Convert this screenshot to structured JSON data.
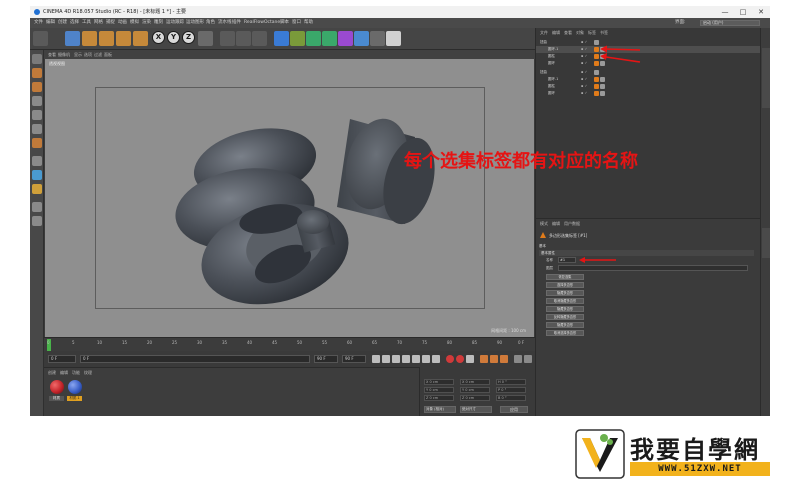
{
  "window": {
    "title": "CINEMA 4D R18.057 Studio (RC - R18) - [未标题 1 *] - 主要",
    "buttons": [
      "—",
      "□",
      "✕"
    ]
  },
  "menubar": {
    "items": [
      "文件",
      "编辑",
      "创建",
      "选择",
      "工具",
      "网格",
      "捕捉",
      "动画",
      "模拟",
      "渲染",
      "雕刻",
      "运动跟踪",
      "运动图形",
      "角色",
      "流水线",
      "插件",
      "RealFlow",
      "Octane",
      "脚本",
      "窗口",
      "帮助"
    ],
    "layout_label": "界面:",
    "layout_value": "启动 (用户)"
  },
  "toolbar": {
    "axis_buttons": [
      "X",
      "Y",
      "Z"
    ]
  },
  "viewport": {
    "menu": [
      "查看",
      "摄像机",
      "显示",
      "选项",
      "过滤",
      "面板"
    ],
    "label": "透视视图",
    "grid_spacing": "网格间距 : 100 cm"
  },
  "timeline": {
    "ticks": [
      "0",
      "5",
      "10",
      "15",
      "20",
      "25",
      "30",
      "35",
      "40",
      "45",
      "50",
      "55",
      "60",
      "65",
      "70",
      "75",
      "80",
      "85",
      "90"
    ],
    "end_label": "0 F"
  },
  "transport": {
    "current_frame": "0 F",
    "start_frame": "0 F",
    "end_frame": "90 F",
    "max_frame": "90 F"
  },
  "materials": {
    "menu": [
      "创建",
      "编辑",
      "功能",
      "纹理"
    ],
    "items": [
      {
        "label": "材质",
        "color": "#c4242a"
      },
      {
        "label": "材质.1",
        "color": "#3a5fc8"
      }
    ]
  },
  "coords": {
    "rows": [
      {
        "a": "X 0 cm",
        "b": "X 0 cm",
        "c": "H 0 °"
      },
      {
        "a": "Y 0 cm",
        "b": "Y 0 cm",
        "c": "P 0 °"
      },
      {
        "a": "Z 0 cm",
        "b": "Z 0 cm",
        "c": "B 0 °"
      }
    ],
    "mode": "对象 (相对)",
    "size_mode": "绝对尺寸",
    "apply": "应用"
  },
  "objects": {
    "menu": [
      "文件",
      "编辑",
      "查看",
      "对象",
      "标签",
      "书签"
    ],
    "rows": [
      {
        "name": "扭曲",
        "indent": 0
      },
      {
        "name": "圆环.1",
        "indent": 1
      },
      {
        "name": "圆柱",
        "indent": 1
      },
      {
        "name": "圆环",
        "indent": 1
      },
      {
        "name": "扭曲",
        "indent": 0
      },
      {
        "name": "圆环.1",
        "indent": 1
      },
      {
        "name": "圆柱",
        "indent": 1
      },
      {
        "name": "圆环",
        "indent": 1
      }
    ]
  },
  "attributes": {
    "menu": [
      "模式",
      "编辑",
      "用户数据"
    ],
    "title": "多边形选集标签 [#1]",
    "tab": "基本",
    "section": "基本属性",
    "name_label": "名称",
    "name_value": "#1",
    "layer_label": "图层",
    "buttons": [
      "恢复选集",
      "选择多边形",
      "隐藏多边形",
      "取消隐藏多边形",
      "隐藏多边形",
      "反转隐藏多边形",
      "隐藏多边形",
      "取消选择多边形"
    ]
  },
  "annotation": {
    "text": "每个选集标签都有对应的名称",
    "color": "#e51414"
  },
  "logo": {
    "brand": "我要自學網",
    "url": "WWW.51ZXW.NET",
    "accent": "#f2b21c"
  },
  "colors": {
    "app_bg": "#3b3b3b",
    "viewport_bg": "#8f8f8f",
    "object_gray": "#4a4f57",
    "arrow_red": "#e51414"
  }
}
